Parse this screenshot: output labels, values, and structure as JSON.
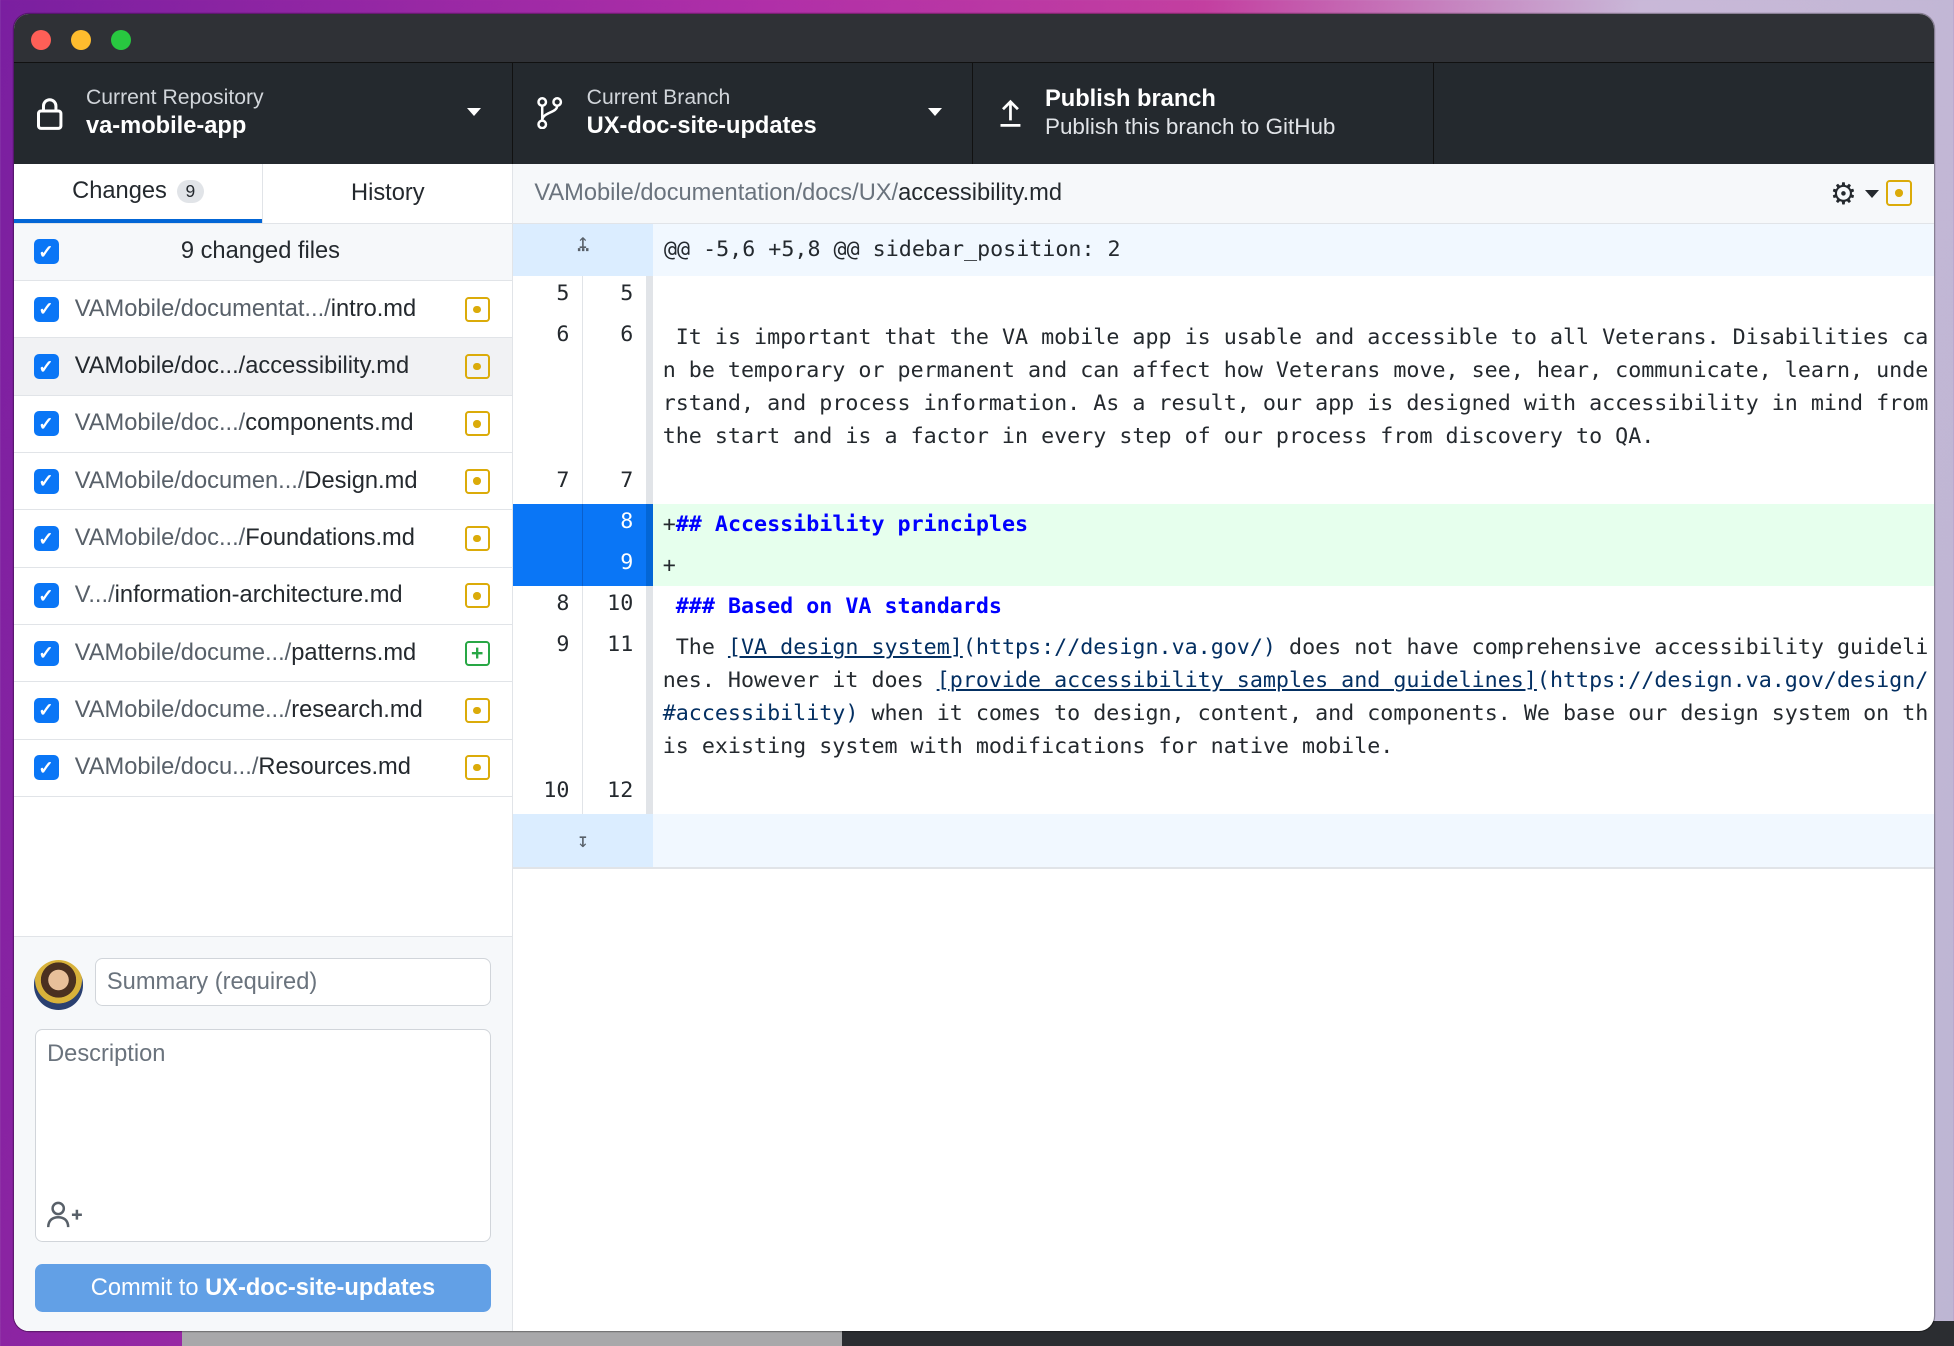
{
  "toolbar": {
    "repository": {
      "label": "Current Repository",
      "value": "va-mobile-app"
    },
    "branch": {
      "label": "Current Branch",
      "value": "UX-doc-site-updates"
    },
    "publish": {
      "label": "Publish branch",
      "value": "Publish this branch to GitHub"
    }
  },
  "tabs": {
    "changes": "Changes",
    "changes_count": "9",
    "history": "History"
  },
  "changes": {
    "header": "9 changed files",
    "files": [
      {
        "dir": "VAMobile/documentat.../",
        "name": "intro.md",
        "status": "modified"
      },
      {
        "dir": "VAMobile/doc.../",
        "name": "accessibility.md",
        "status": "modified",
        "selected": true
      },
      {
        "dir": "VAMobile/doc.../",
        "name": "components.md",
        "status": "modified"
      },
      {
        "dir": "VAMobile/documen.../",
        "name": "Design.md",
        "status": "modified"
      },
      {
        "dir": "VAMobile/doc.../",
        "name": "Foundations.md",
        "status": "modified"
      },
      {
        "dir": "V.../",
        "name": "information-architecture.md",
        "status": "modified"
      },
      {
        "dir": "VAMobile/docume.../",
        "name": "patterns.md",
        "status": "added"
      },
      {
        "dir": "VAMobile/docume.../",
        "name": "research.md",
        "status": "modified"
      },
      {
        "dir": "VAMobile/docu.../",
        "name": "Resources.md",
        "status": "modified"
      }
    ]
  },
  "commit": {
    "summary_placeholder": "Summary (required)",
    "description_placeholder": "Description",
    "button_prefix": "Commit to ",
    "button_branch": "UX-doc-site-updates"
  },
  "diff": {
    "path_dir": "VAMobile/documentation/docs/UX/",
    "path_file": "accessibility.md",
    "hunk": "@@ -5,6 +5,8 @@ sidebar_position: 2",
    "lines": [
      {
        "old": "5",
        "new": "5",
        "text": ""
      },
      {
        "old": "6",
        "new": "6",
        "text": " It is important that the VA mobile app is usable and accessible to all Veterans. Disabilities can be temporary or permanent and can affect how Veterans move, see, hear, communicate, learn, understand, and process information. As a result, our app is designed with accessibility in mind from the start and is a factor in every step of our process from discovery to QA."
      },
      {
        "old": "7",
        "new": "7",
        "text": ""
      },
      {
        "old": "",
        "new": "8",
        "prefix": "+",
        "heading": "## Accessibility principles"
      },
      {
        "old": "",
        "new": "9",
        "text": "+"
      },
      {
        "old": "8",
        "new": "10",
        "prefix": " ",
        "heading": "### Based on VA standards"
      },
      {
        "old": "9",
        "new": "11",
        "seg": [
          " The ",
          "[VA design system]",
          "(https://design.va.gov/)",
          " does not have comprehensive accessibility guidelines. However it does ",
          "[provide accessibility samples and guidelines]",
          "(https://design.va.gov/design/#accessibility)",
          " when it comes to design, content, and components. We base our design system on this existing system with modifications for native mobile."
        ]
      },
      {
        "old": "10",
        "new": "12",
        "text": ""
      }
    ]
  },
  "colors": {
    "accent": "#0366d6",
    "modified": "#dbab09",
    "added": "#28a745",
    "commit_button": "#62a0e6"
  }
}
